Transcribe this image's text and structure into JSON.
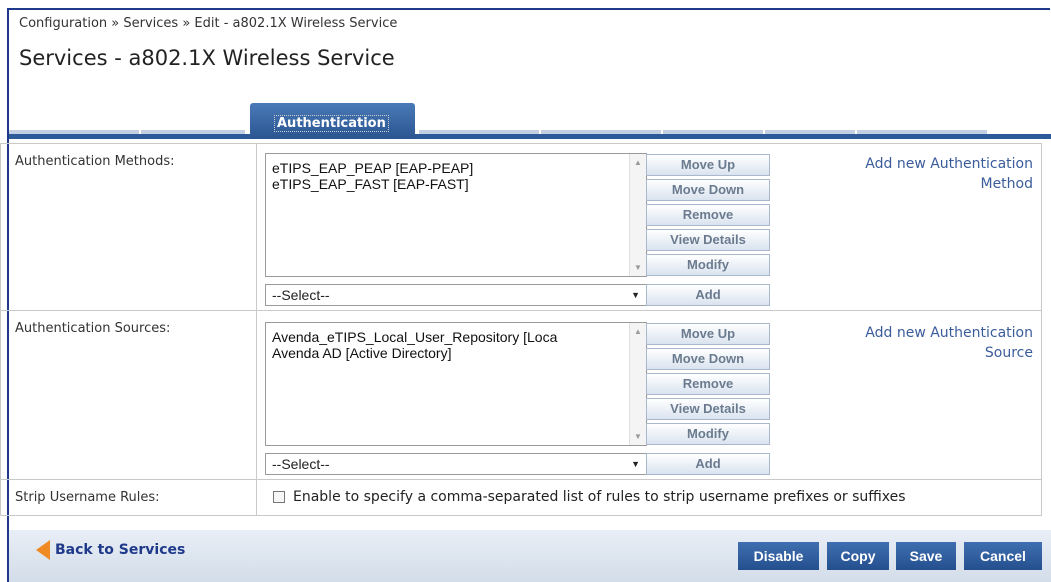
{
  "breadcrumb": "Configuration » Services » Edit - a802.1X Wireless Service",
  "title": "Services - a802.1X Wireless Service",
  "tabs": [
    {
      "label": "Authentication",
      "active": true
    }
  ],
  "methods": {
    "label": "Authentication Methods:",
    "items": [
      "eTIPS_EAP_PEAP [EAP-PEAP]",
      "eTIPS_EAP_FAST [EAP-FAST]"
    ],
    "select_value": "--Select--",
    "add_link_line1": "Add new Authentication",
    "add_link_line2": "Method"
  },
  "sources": {
    "label": "Authentication Sources:",
    "items": [
      "Avenda_eTIPS_Local_User_Repository [Loca",
      "Avenda AD [Active Directory]"
    ],
    "select_value": "--Select--",
    "add_link_line1": "Add new Authentication",
    "add_link_line2": "Source"
  },
  "buttons": {
    "move_up": "Move Up",
    "move_down": "Move Down",
    "remove": "Remove",
    "view_details": "View Details",
    "modify": "Modify",
    "add": "Add"
  },
  "strip": {
    "label": "Strip Username Rules:",
    "checkbox_text": "Enable to specify a comma-separated list of rules to strip username prefixes or suffixes",
    "checked": false
  },
  "footer": {
    "back_label": "Back to Services",
    "disable": "Disable",
    "copy": "Copy",
    "save": "Save",
    "cancel": "Cancel"
  },
  "colors": {
    "accent": "#2d5b9a",
    "link": "#3a5c9b",
    "back_arrow": "#f08a24"
  }
}
